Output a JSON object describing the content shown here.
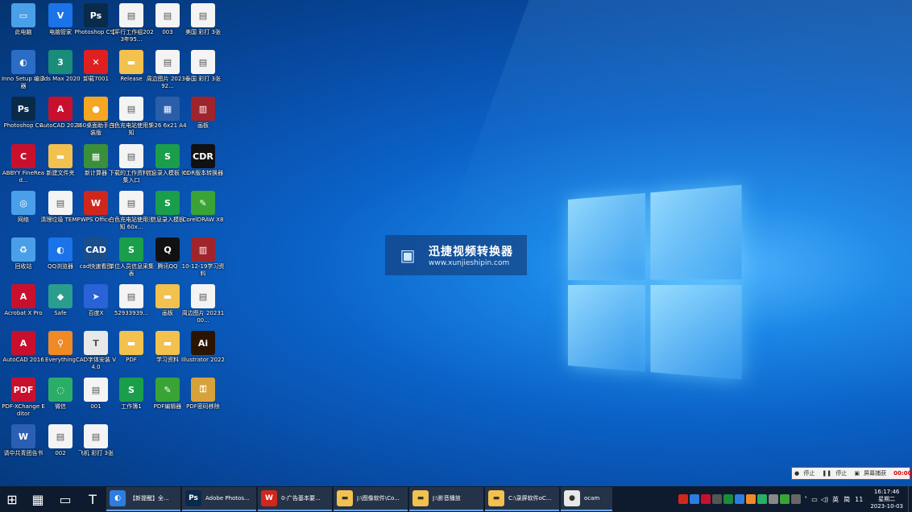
{
  "desktop": {
    "icons": [
      {
        "label": "此电脑",
        "color": "#4aa0e8",
        "glyph": "▭"
      },
      {
        "label": "电脑管家",
        "color": "#1a73e8",
        "glyph": "V"
      },
      {
        "label": "Photoshop CS3",
        "color": "#0a2a4a",
        "glyph": "Ps"
      },
      {
        "label": "【平行工作组2023年95...",
        "color": "#f4f4f4",
        "glyph": "▤"
      },
      {
        "label": "003",
        "color": "#f4f4f4",
        "glyph": "▤"
      },
      {
        "label": "美国 彩打 3张",
        "color": "#f4f4f4",
        "glyph": "▤"
      },
      {
        "label": "Inno Setup 编译器",
        "color": "#2b6cc4",
        "glyph": "◐"
      },
      {
        "label": "3ds Max 2020",
        "color": "#1a8c7a",
        "glyph": "3"
      },
      {
        "label": "卸载7001",
        "color": "#e02020",
        "glyph": "✕"
      },
      {
        "label": "Release",
        "color": "#f2c14e",
        "glyph": "▬"
      },
      {
        "label": "周边图片 2023092...",
        "color": "#f4f4f4",
        "glyph": "▤"
      },
      {
        "label": "泰国 彩打 3张",
        "color": "#f4f4f4",
        "glyph": "▤"
      },
      {
        "label": "Photoshop CC",
        "color": "#0a2a4a",
        "glyph": "Ps"
      },
      {
        "label": "AutoCAD 2023",
        "color": "#c8102e",
        "glyph": "A"
      },
      {
        "label": "360桌面助手 安装版",
        "color": "#f5a623",
        "glyph": "●"
      },
      {
        "label": "白色充电站使用须知",
        "color": "#f4f4f4",
        "glyph": "▤"
      },
      {
        "label": "9-26 6x21 A4",
        "color": "#2a5ea8",
        "glyph": "▦"
      },
      {
        "label": "画板",
        "color": "#a0242c",
        "glyph": "▥"
      },
      {
        "label": "ABBYY FineRead...",
        "color": "#c8102e",
        "glyph": "C"
      },
      {
        "label": "新建文件夹",
        "color": "#f2c14e",
        "glyph": "▬"
      },
      {
        "label": "新计算器",
        "color": "#3b8f3b",
        "glyph": "▦"
      },
      {
        "label": "下载的工作资料合集入口",
        "color": "#f4f4f4",
        "glyph": "▤"
      },
      {
        "label": "信息录入模板 (6)",
        "color": "#1b9e4b",
        "glyph": "S"
      },
      {
        "label": "CDR版本转换器",
        "color": "#111",
        "glyph": "CDR"
      },
      {
        "label": "网络",
        "color": "#4aa0e8",
        "glyph": "◎"
      },
      {
        "label": "清理垃圾 TEMP",
        "color": "#f4f4f4",
        "glyph": "▤"
      },
      {
        "label": "WPS Office",
        "color": "#d0271c",
        "glyph": "W"
      },
      {
        "label": "白色充电站使用须知 60x...",
        "color": "#f4f4f4",
        "glyph": "▤"
      },
      {
        "label": "信息录入模板",
        "color": "#1b9e4b",
        "glyph": "S"
      },
      {
        "label": "CorelDRAW X8",
        "color": "#3aa335",
        "glyph": "✎"
      },
      {
        "label": "回收站",
        "color": "#4aa0e8",
        "glyph": "♻"
      },
      {
        "label": "QQ浏览器",
        "color": "#1a73e8",
        "glyph": "◐"
      },
      {
        "label": "cad快速看图",
        "color": "#1a4d8c",
        "glyph": "CAD"
      },
      {
        "label": "单位人员信息采集表",
        "color": "#1b9e4b",
        "glyph": "S"
      },
      {
        "label": "腾讯QQ",
        "color": "#111",
        "glyph": "Q"
      },
      {
        "label": "10-12-19学习资料",
        "color": "#a0242c",
        "glyph": "▥"
      },
      {
        "label": "Acrobat X Pro",
        "color": "#c8102e",
        "glyph": "A"
      },
      {
        "label": "Safe",
        "color": "#2a9d8f",
        "glyph": "◆"
      },
      {
        "label": "百度X",
        "color": "#2a62d8",
        "glyph": "➤"
      },
      {
        "label": "52933939...",
        "color": "#f4f4f4",
        "glyph": "▤"
      },
      {
        "label": "画板",
        "color": "#f2c14e",
        "glyph": "▬"
      },
      {
        "label": "周边图片 2023100...",
        "color": "#f4f4f4",
        "glyph": "▤"
      },
      {
        "label": "AutoCAD 2016",
        "color": "#c8102e",
        "glyph": "A"
      },
      {
        "label": "Everything",
        "color": "#f08a24",
        "glyph": "⚲"
      },
      {
        "label": "CAD字体安装 V4.0",
        "color": "#e8e8e8",
        "glyph": "T"
      },
      {
        "label": "PDF",
        "color": "#f2c14e",
        "glyph": "▬"
      },
      {
        "label": "学习资料",
        "color": "#f2c14e",
        "glyph": "▬"
      },
      {
        "label": "Illustrator 2022",
        "color": "#2b1400",
        "glyph": "Ai"
      },
      {
        "label": "PDF-XChange Editor",
        "color": "#c8102e",
        "glyph": "PDF"
      },
      {
        "label": "微信",
        "color": "#2aae67",
        "glyph": "◌"
      },
      {
        "label": "001",
        "color": "#f4f4f4",
        "glyph": "▤"
      },
      {
        "label": "工作簿1",
        "color": "#1b9e4b",
        "glyph": "S"
      },
      {
        "label": "PDF编辑器",
        "color": "#3aa335",
        "glyph": "✎"
      },
      {
        "label": "PDF密码移除",
        "color": "#d8a23a",
        "glyph": "⚿"
      },
      {
        "label": "请中共青团告书",
        "color": "#2b5fb4",
        "glyph": "W"
      },
      {
        "label": "002",
        "color": "#f4f4f4",
        "glyph": "▤"
      },
      {
        "label": "飞机 彩打 3张",
        "color": "#f4f4f4",
        "glyph": "▤"
      }
    ]
  },
  "watermark": {
    "title": "迅捷视频转换器",
    "url": "www.xunjieshipin.com"
  },
  "ocam": {
    "stop1": "停止",
    "pause": "停止",
    "capture": "屏幕捕获",
    "timer": "00:00:00"
  },
  "taskbar": {
    "apps": [
      {
        "label": "【新提醒】全...",
        "color": "#2d7de0",
        "glyph": "◐"
      },
      {
        "label": "Adobe Photos...",
        "color": "#0a2a4a",
        "glyph": "Ps"
      },
      {
        "label": "0-广告基本要...",
        "color": "#d0271c",
        "glyph": "W"
      },
      {
        "label": "J:\\图像软件\\Co...",
        "color": "#f2c14e",
        "glyph": "▬"
      },
      {
        "label": "J:\\影音播放",
        "color": "#f2c14e",
        "glyph": "▬"
      },
      {
        "label": "C:\\录屏软件oC...",
        "color": "#f2c14e",
        "glyph": "▬"
      },
      {
        "label": "ocam",
        "color": "#e8e8e8",
        "glyph": "●"
      }
    ],
    "tray": {
      "ime": "英",
      "ime2": "简",
      "day_num": "11",
      "time": "16:17:46",
      "weekday": "星期二",
      "date": "2023-10-03"
    }
  }
}
